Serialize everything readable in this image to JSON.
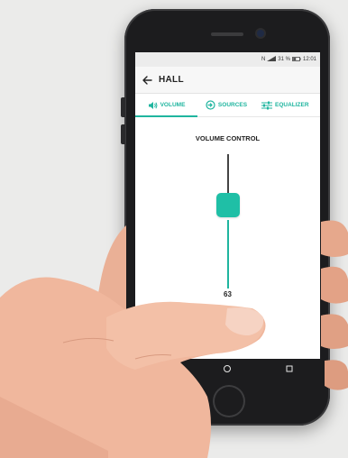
{
  "status_bar": {
    "battery_text": "31 %",
    "time": "12:01",
    "icons": [
      "nfc-icon",
      "signal-icon",
      "battery-icon"
    ]
  },
  "app_bar": {
    "title": "HALL",
    "back_icon": "arrow-left-icon"
  },
  "tabs": [
    {
      "label": "VOLUME",
      "icon": "speaker-icon",
      "active": true
    },
    {
      "label": "SOURCES",
      "icon": "input-icon",
      "active": false
    },
    {
      "label": "EQUALIZER",
      "icon": "sliders-icon",
      "active": false
    }
  ],
  "volume": {
    "title": "VOLUME CONTROL",
    "value": "63"
  },
  "nav_bar": {
    "icons": [
      "recent-apps-icon",
      "home-circle-icon",
      "overview-square-icon"
    ]
  },
  "colors": {
    "accent": "#1fb59f",
    "thumb": "#1fbfa6",
    "phone": "#1c1c1e",
    "background": "#ebebea"
  }
}
